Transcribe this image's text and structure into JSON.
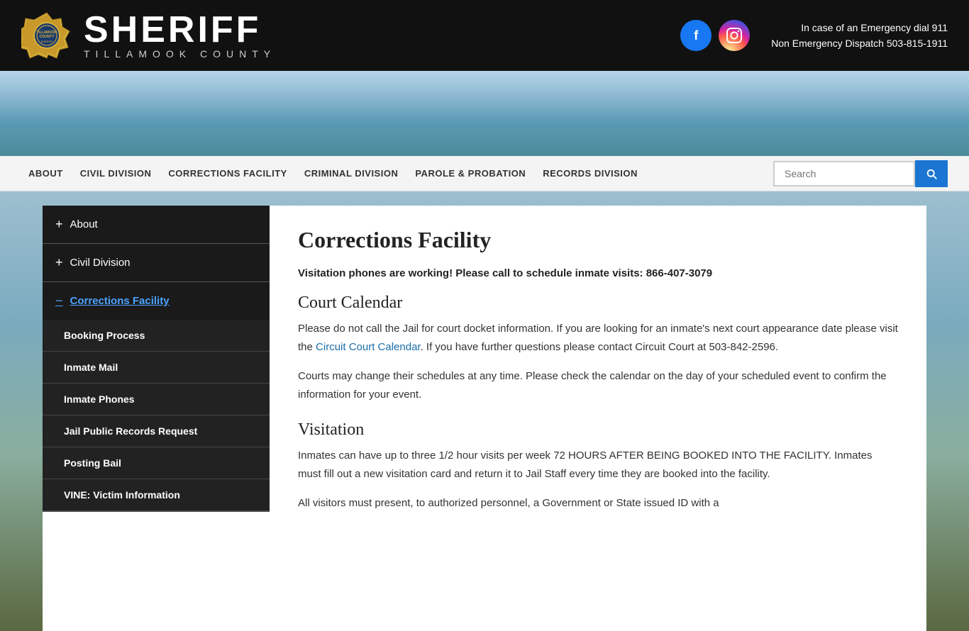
{
  "header": {
    "sheriff_title": "SHERIFF",
    "sheriff_subtitle": "TILLAMOOK COUNTY",
    "emergency_line1": "In case of an Emergency dial 911",
    "emergency_line2": "Non Emergency Dispatch 503-815-1911",
    "facebook_label": "f",
    "instagram_label": "ig"
  },
  "nav": {
    "links": [
      {
        "id": "about",
        "label": "ABOUT"
      },
      {
        "id": "civil",
        "label": "CIVIL DIVISION"
      },
      {
        "id": "corrections",
        "label": "CORRECTIONS FACILITY"
      },
      {
        "id": "criminal",
        "label": "CRIMINAL DIVISION"
      },
      {
        "id": "parole",
        "label": "PAROLE & PROBATION"
      },
      {
        "id": "records",
        "label": "RECORDS DIVISION"
      }
    ],
    "search_placeholder": "Search"
  },
  "sidebar": {
    "items": [
      {
        "id": "about",
        "label": "About",
        "type": "expand",
        "active": false
      },
      {
        "id": "civil-division",
        "label": "Civil Division",
        "type": "expand",
        "active": false
      },
      {
        "id": "corrections-facility",
        "label": "Corrections Facility",
        "type": "collapse",
        "active": true
      }
    ],
    "sub_items": [
      {
        "id": "booking-process",
        "label": "Booking Process"
      },
      {
        "id": "inmate-mail",
        "label": "Inmate Mail"
      },
      {
        "id": "inmate-phones",
        "label": "Inmate Phones"
      },
      {
        "id": "jail-public-records",
        "label": "Jail Public Records Request"
      },
      {
        "id": "posting-bail",
        "label": "Posting Bail"
      },
      {
        "id": "vine-victim",
        "label": "VINE: Victim Information"
      }
    ]
  },
  "content": {
    "title": "Corrections Facility",
    "alert": "Visitation phones are working! Please call to schedule inmate visits: 866-407-3079",
    "court_calendar_title": "Court Calendar",
    "court_calendar_text1": "Please do not call the Jail for court docket information.  If you are looking for an inmate's next court appearance date please visit the ",
    "court_calendar_link_text": "Circuit Court Calendar",
    "court_calendar_text2": ".  If you have further questions please contact Circuit Court at 503-842-2596.",
    "court_calendar_text3": "Courts may change their schedules at any time. Please check the calendar on the day of your scheduled event to confirm the information for your event.",
    "visitation_title": "Visitation",
    "visitation_text1": "Inmates can have up to three 1/2 hour visits per week 72 HOURS AFTER BEING BOOKED INTO THE FACILITY.  Inmates must fill out a new visitation card and return it to Jail Staff every time they are booked into the facility.",
    "visitation_text2": "All visitors must present, to authorized personnel, a Government or State issued ID with a"
  }
}
